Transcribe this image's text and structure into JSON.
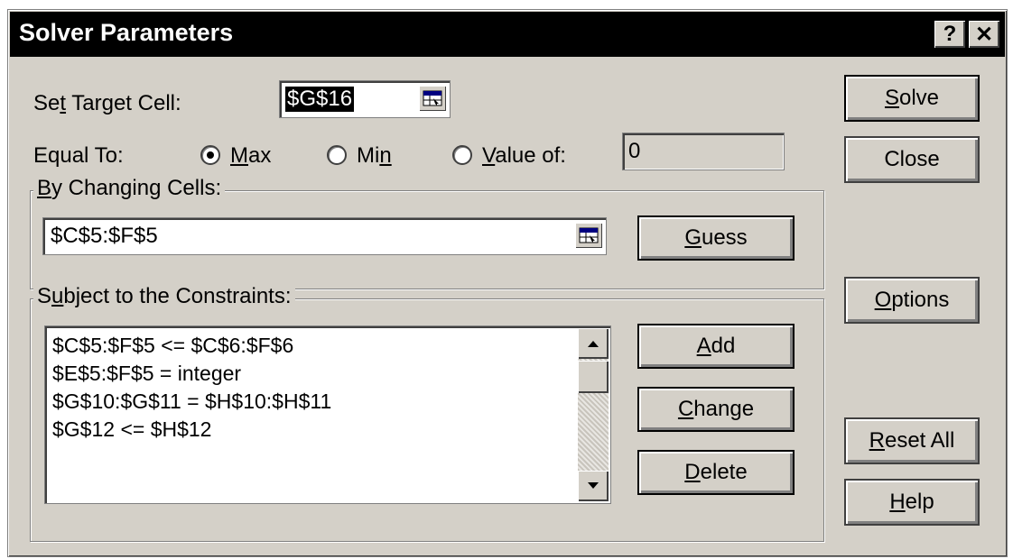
{
  "window": {
    "title": "Solver Parameters",
    "help_glyph": "?",
    "close_glyph": "✕"
  },
  "target": {
    "label_pre": "Se",
    "label_acc": "t",
    "label_post": " Target Cell:",
    "value": "$G$16"
  },
  "equal_to": {
    "label": "Equal To:",
    "options": [
      {
        "pre": "",
        "acc": "M",
        "post": "ax",
        "selected": true
      },
      {
        "pre": "Mi",
        "acc": "n",
        "post": "",
        "selected": false
      },
      {
        "pre": "",
        "acc": "V",
        "post": "alue of:",
        "selected": false
      }
    ],
    "value_of": "0"
  },
  "changing": {
    "title_pre": "",
    "title_acc": "B",
    "title_post": "y Changing Cells:",
    "value": "$C$5:$F$5",
    "guess_pre": "",
    "guess_acc": "G",
    "guess_post": "uess"
  },
  "constraints": {
    "title_pre": "S",
    "title_acc": "u",
    "title_post": "bject to the Constraints:",
    "items": [
      "$C$5:$F$5 <= $C$6:$F$6",
      "$E$5:$F$5 = integer",
      "$G$10:$G$11 = $H$10:$H$11",
      "$G$12 <= $H$12"
    ],
    "add": {
      "pre": "",
      "acc": "A",
      "post": "dd"
    },
    "change": {
      "pre": "",
      "acc": "C",
      "post": "hange"
    },
    "delete": {
      "pre": "",
      "acc": "D",
      "post": "elete"
    }
  },
  "side": {
    "solve": {
      "pre": "",
      "acc": "S",
      "post": "olve"
    },
    "close": "Close",
    "options": {
      "pre": "",
      "acc": "O",
      "post": "ptions"
    },
    "reset": {
      "pre": "",
      "acc": "R",
      "post": "eset All"
    },
    "help": {
      "pre": "",
      "acc": "H",
      "post": "elp"
    }
  },
  "colors": {
    "titlebar": "#000000",
    "face": "#d4d0c8"
  },
  "icons": [
    "ref-edit-icon",
    "scroll-up-icon",
    "scroll-down-icon",
    "radio-icon"
  ]
}
